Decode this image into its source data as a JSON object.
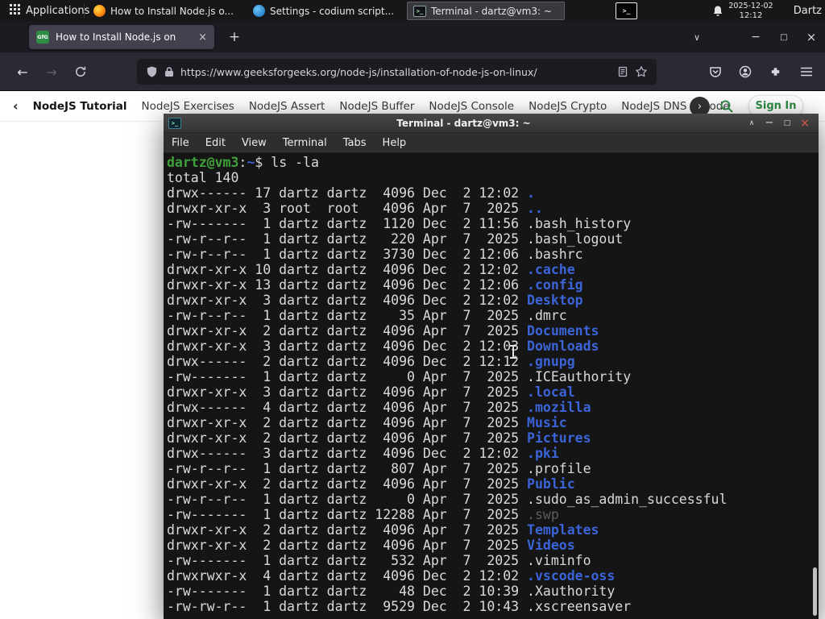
{
  "colors": {
    "gfg_green": "#2f8d46",
    "dir_blue": "#3b64d8",
    "prompt_green": "#3fa13a",
    "terminal_bg": "#151515",
    "panel_bg": "#17171a",
    "close_red": "#e4584a",
    "firefox_orange": "#ff9e17"
  },
  "icons": [
    "applications-grid-icon",
    "firefox-icon",
    "codium-icon",
    "terminal-icon",
    "tray-terminal-icon",
    "bell-icon",
    "back-icon",
    "forward-icon",
    "refresh-icon",
    "shield-icon",
    "lock-icon",
    "reader-mode-icon",
    "bookmark-star-icon",
    "pocket-icon",
    "account-icon",
    "extensions-icon",
    "menu-hamburger-icon",
    "search-icon",
    "nav-scroll-left-icon",
    "nav-scroll-right-icon",
    "close-icon"
  ],
  "panel": {
    "applications_label": "Applications",
    "tasks": [
      {
        "label": "How to Install Node.js o...",
        "icon": "firefox-icon"
      },
      {
        "label": "Settings - codium script...",
        "icon": "codium-icon"
      },
      {
        "label": "Terminal - dartz@vm3: ~",
        "icon": "terminal-icon"
      }
    ],
    "clock": {
      "date": "2025-12-02",
      "time": "12:12"
    },
    "user": "Dartz"
  },
  "browser": {
    "tab_title": "How to Install Node.js on",
    "tab_close": "×",
    "new_tab_label": "+",
    "tabs_chevron": "∨",
    "window_controls": {
      "minimize": "−",
      "maximize": "□",
      "close": "×"
    },
    "back": "←",
    "forward": "→",
    "url": "https://www.geeksforgeeks.org/node-js/installation-of-node-js-on-linux/",
    "favicon_text": "GfG",
    "site_nav": {
      "back_chevron": "‹",
      "active_item": "NodeJS Tutorial",
      "links": [
        "NodeJS Exercises",
        "NodeJS Assert",
        "NodeJS Buffer",
        "NodeJS Console",
        "NodeJS Crypto",
        "NodeJS DNS",
        "Node"
      ],
      "forward_chevron": "›",
      "sign_in_label": "Sign In"
    }
  },
  "terminal": {
    "window_title": "Terminal - dartz@vm3: ~",
    "window_buttons": {
      "shade": "∧",
      "minimize": "−",
      "maximize": "□",
      "close": "×"
    },
    "menu": [
      "File",
      "Edit",
      "View",
      "Terminal",
      "Tabs",
      "Help"
    ],
    "prompt": {
      "user_host": "dartz@vm3",
      "separator": ":",
      "path": "~",
      "symbol": "$"
    },
    "command": "ls -la",
    "total_line": "total 140",
    "listing": [
      [
        "drwx------",
        "17",
        "dartz",
        "dartz",
        "4096",
        "Dec",
        "2",
        "12:02",
        ".",
        "dir"
      ],
      [
        "drwxr-xr-x",
        "3",
        "root",
        "root",
        "4096",
        "Apr",
        "7",
        "2025",
        "..",
        "dir"
      ],
      [
        "-rw-------",
        "1",
        "dartz",
        "dartz",
        "1120",
        "Dec",
        "2",
        "11:56",
        ".bash_history",
        "file"
      ],
      [
        "-rw-r--r--",
        "1",
        "dartz",
        "dartz",
        "220",
        "Apr",
        "7",
        "2025",
        ".bash_logout",
        "file"
      ],
      [
        "-rw-r--r--",
        "1",
        "dartz",
        "dartz",
        "3730",
        "Dec",
        "2",
        "12:06",
        ".bashrc",
        "file"
      ],
      [
        "drwxr-xr-x",
        "10",
        "dartz",
        "dartz",
        "4096",
        "Dec",
        "2",
        "12:02",
        ".cache",
        "dir"
      ],
      [
        "drwxr-xr-x",
        "13",
        "dartz",
        "dartz",
        "4096",
        "Dec",
        "2",
        "12:06",
        ".config",
        "dir"
      ],
      [
        "drwxr-xr-x",
        "3",
        "dartz",
        "dartz",
        "4096",
        "Dec",
        "2",
        "12:02",
        "Desktop",
        "dir"
      ],
      [
        "-rw-r--r--",
        "1",
        "dartz",
        "dartz",
        "35",
        "Apr",
        "7",
        "2025",
        ".dmrc",
        "file"
      ],
      [
        "drwxr-xr-x",
        "2",
        "dartz",
        "dartz",
        "4096",
        "Apr",
        "7",
        "2025",
        "Documents",
        "dir"
      ],
      [
        "drwxr-xr-x",
        "3",
        "dartz",
        "dartz",
        "4096",
        "Dec",
        "2",
        "12:03",
        "Downloads",
        "dir"
      ],
      [
        "drwx------",
        "2",
        "dartz",
        "dartz",
        "4096",
        "Dec",
        "2",
        "12:12",
        ".gnupg",
        "dir"
      ],
      [
        "-rw-------",
        "1",
        "dartz",
        "dartz",
        "0",
        "Apr",
        "7",
        "2025",
        ".ICEauthority",
        "file"
      ],
      [
        "drwxr-xr-x",
        "3",
        "dartz",
        "dartz",
        "4096",
        "Apr",
        "7",
        "2025",
        ".local",
        "dir"
      ],
      [
        "drwx------",
        "4",
        "dartz",
        "dartz",
        "4096",
        "Apr",
        "7",
        "2025",
        ".mozilla",
        "dir"
      ],
      [
        "drwxr-xr-x",
        "2",
        "dartz",
        "dartz",
        "4096",
        "Apr",
        "7",
        "2025",
        "Music",
        "dir"
      ],
      [
        "drwxr-xr-x",
        "2",
        "dartz",
        "dartz",
        "4096",
        "Apr",
        "7",
        "2025",
        "Pictures",
        "dir"
      ],
      [
        "drwx------",
        "3",
        "dartz",
        "dartz",
        "4096",
        "Dec",
        "2",
        "12:02",
        ".pki",
        "dir"
      ],
      [
        "-rw-r--r--",
        "1",
        "dartz",
        "dartz",
        "807",
        "Apr",
        "7",
        "2025",
        ".profile",
        "file"
      ],
      [
        "drwxr-xr-x",
        "2",
        "dartz",
        "dartz",
        "4096",
        "Apr",
        "7",
        "2025",
        "Public",
        "dir"
      ],
      [
        "-rw-r--r--",
        "1",
        "dartz",
        "dartz",
        "0",
        "Apr",
        "7",
        "2025",
        ".sudo_as_admin_successful",
        "file"
      ],
      [
        "-rw-------",
        "1",
        "dartz",
        "dartz",
        "12288",
        "Apr",
        "7",
        "2025",
        ".swp",
        "dim"
      ],
      [
        "drwxr-xr-x",
        "2",
        "dartz",
        "dartz",
        "4096",
        "Apr",
        "7",
        "2025",
        "Templates",
        "dir"
      ],
      [
        "drwxr-xr-x",
        "2",
        "dartz",
        "dartz",
        "4096",
        "Apr",
        "7",
        "2025",
        "Videos",
        "dir"
      ],
      [
        "-rw-------",
        "1",
        "dartz",
        "dartz",
        "532",
        "Apr",
        "7",
        "2025",
        ".viminfo",
        "file"
      ],
      [
        "drwxrwxr-x",
        "4",
        "dartz",
        "dartz",
        "4096",
        "Dec",
        "2",
        "12:02",
        ".vscode-oss",
        "dir"
      ],
      [
        "-rw-------",
        "1",
        "dartz",
        "dartz",
        "48",
        "Dec",
        "2",
        "10:39",
        ".Xauthority",
        "file"
      ],
      [
        "-rw-rw-r--",
        "1",
        "dartz",
        "dartz",
        "9529",
        "Dec",
        "2",
        "10:43",
        ".xscreensaver",
        "file"
      ]
    ]
  }
}
